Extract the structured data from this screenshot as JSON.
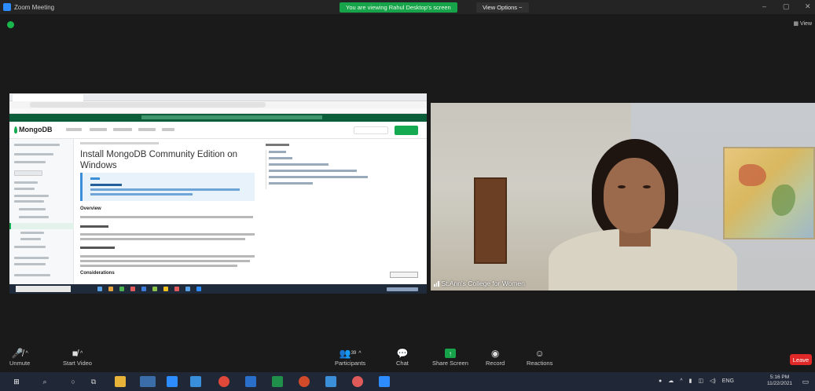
{
  "window": {
    "title": "Zoom Meeting",
    "share_status": "You are viewing Rahul Desktop's screen",
    "view_options": "View Options ~",
    "minimize_glyph": "–",
    "maximize_glyph": "▢",
    "close_glyph": "✕",
    "view_label": "View"
  },
  "shared_screen": {
    "brand": "MongoDB",
    "doc_title": "Install MongoDB Community Edition on Windows",
    "section_overview": "Overview",
    "section_considerations": "Considerations"
  },
  "video_tile": {
    "participant_name": "St.Ann's College for Women"
  },
  "toolbar": {
    "unmute": "Unmute",
    "start_video": "Start Video",
    "participants": "Participants",
    "participants_count": "39",
    "chat": "Chat",
    "share_screen": "Share Screen",
    "record": "Record",
    "reactions": "Reactions",
    "leave": "Leave"
  },
  "taskbar": {
    "language": "ENG",
    "time": "5:16 PM",
    "date": "11/22/2021"
  },
  "colors": {
    "share_banner": "#16a34a",
    "leave": "#e02828",
    "mongodb_green": "#13aa52"
  }
}
